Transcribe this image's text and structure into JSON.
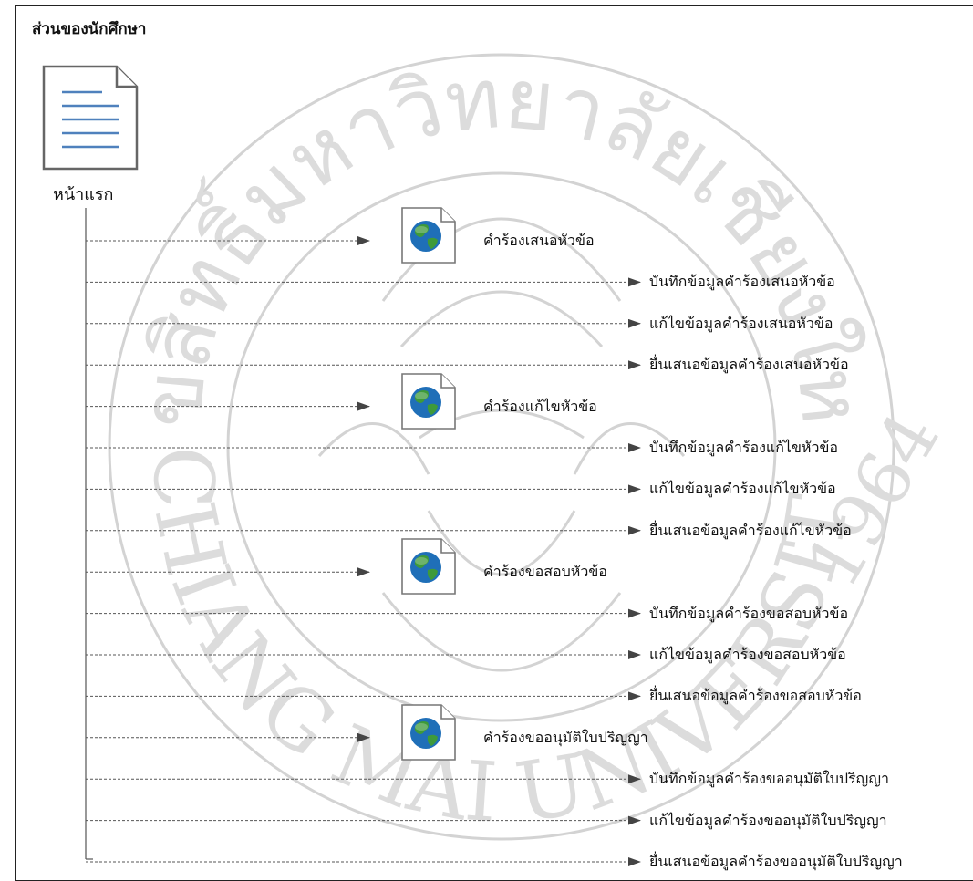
{
  "section_title": "ส่วนของนักศึกษา",
  "home_label": "หน้าแรก",
  "watermark": {
    "text_thai": "ลิขสิทธิ์มหาวิทยาลัยเชียงใหม่",
    "text_english": "CHIANG MAI UNIVERSITY",
    "year": "1964",
    "color": "#c8c8c8"
  },
  "colors": {
    "line": "#555555",
    "arrow": "#444444",
    "doc_lines": "#4f81bd",
    "globe_ocean": "#1f6fb8",
    "globe_land": "#3e9a3a"
  },
  "icons": {
    "home": "document-icon",
    "page": "web-page-globe-icon"
  },
  "groups": [
    {
      "page": "คำร้องเสนอหัวข้อ",
      "actions": [
        "บันทึกข้อมูลคำร้องเสนอหัวข้อ",
        "แก้ไขข้อมูลคำร้องเสนอหัวข้อ",
        "ยื่นเสนอข้อมูลคำร้องเสนอหัวข้อ"
      ]
    },
    {
      "page": "คำร้องแก้ไขหัวข้อ",
      "actions": [
        "บันทึกข้อมูลคำร้องแก้ไขหัวข้อ",
        "แก้ไขข้อมูลคำร้องแก้ไขหัวข้อ",
        "ยื่นเสนอข้อมูลคำร้องแก้ไขหัวข้อ"
      ]
    },
    {
      "page": "คำร้องขอสอบหัวข้อ",
      "actions": [
        "บันทึกข้อมูลคำร้องขอสอบหัวข้อ",
        "แก้ไขข้อมูลคำร้องขอสอบหัวข้อ",
        "ยื่นเสนอข้อมูลคำร้องขอสอบหัวข้อ"
      ]
    },
    {
      "page": "คำร้องขออนุมัติใบปริญญา",
      "actions": [
        "บันทึกข้อมูลคำร้องขออนุมัติใบปริญญา",
        "แก้ไขข้อมูลคำร้องขออนุมัติใบปริญญา",
        "ยื่นเสนอข้อมูลคำร้องขออนุมัติใบปริญญา"
      ]
    }
  ]
}
